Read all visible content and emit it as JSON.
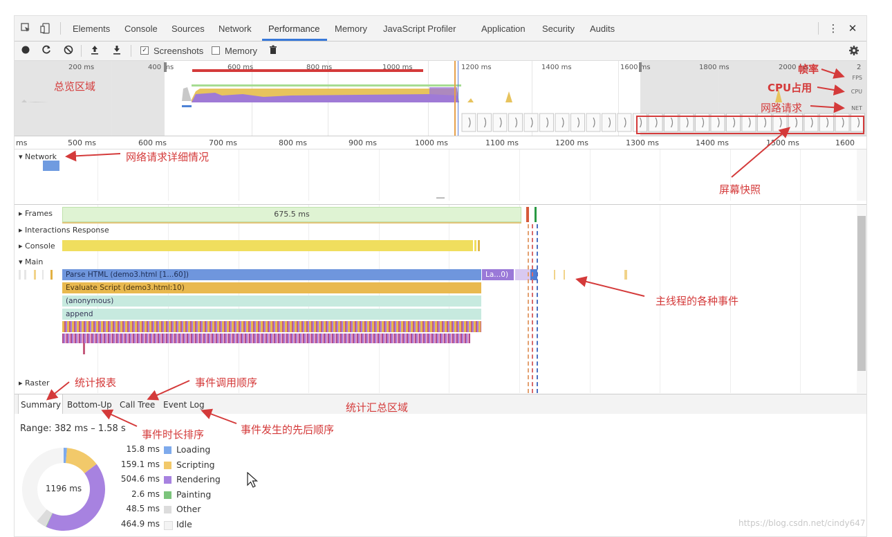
{
  "tabs": [
    "Elements",
    "Console",
    "Sources",
    "Network",
    "Performance",
    "Memory",
    "JavaScript Profiler",
    "Application",
    "Security",
    "Audits"
  ],
  "toolbar": {
    "screenshots_label": "Screenshots",
    "memory_label": "Memory"
  },
  "overview": {
    "ticks": [
      "200 ms",
      "400 ms",
      "600 ms",
      "800 ms",
      "1000 ms",
      "1200 ms",
      "1400 ms",
      "1600 ms",
      "1800 ms",
      "2000 ms",
      "2"
    ],
    "fps_label": "FPS",
    "cpu_label": "CPU",
    "net_label": "NET"
  },
  "ruler": {
    "ticks": [
      "ms",
      "500 ms",
      "600 ms",
      "700 ms",
      "800 ms",
      "900 ms",
      "1000 ms",
      "1100 ms",
      "1200 ms",
      "1300 ms",
      "1400 ms",
      "1500 ms",
      "1600"
    ]
  },
  "network": {
    "label": "Network"
  },
  "tracks": {
    "frames": "Frames",
    "frames_time": "675.5 ms",
    "interactions": "Interactions Response",
    "console": "Console",
    "main": "Main",
    "raster": "Raster"
  },
  "main_events": {
    "parse": "Parse HTML (demo3.html [1...60])",
    "layout": "La...0)",
    "evaluate": "Evaluate Script (demo3.html:10)",
    "anonymous": "(anonymous)",
    "append": "append"
  },
  "bottom_tabs": [
    "Summary",
    "Bottom-Up",
    "Call Tree",
    "Event Log"
  ],
  "summary": {
    "range": "Range: 382 ms – 1.58 s",
    "total": "1196 ms",
    "items": [
      {
        "value": "15.8 ms",
        "name": "Loading",
        "color": "#7eaaec",
        "ms": 15.8
      },
      {
        "value": "159.1 ms",
        "name": "Scripting",
        "color": "#f2c96a",
        "ms": 159.1
      },
      {
        "value": "504.6 ms",
        "name": "Rendering",
        "color": "#a782e0",
        "ms": 504.6
      },
      {
        "value": "2.6 ms",
        "name": "Painting",
        "color": "#7cc47c",
        "ms": 2.6
      },
      {
        "value": "48.5 ms",
        "name": "Other",
        "color": "#dcdcdc",
        "ms": 48.5
      },
      {
        "value": "464.9 ms",
        "name": "Idle",
        "color": "#f4f4f4",
        "ms": 464.9
      }
    ]
  },
  "annotations": {
    "overview": "总览区域",
    "fps": "帧率",
    "cpu": "CPU占用",
    "net": "网路请求",
    "network_detail": "网络请求详细情况",
    "screenshots": "屏幕快照",
    "main_events": "主线程的各种事件",
    "stats_report": "统计报表",
    "call_order": "事件调用顺序",
    "summary_area": "统计汇总区域",
    "duration_sort": "事件时长排序",
    "event_order": "事件发生的先后顺序"
  },
  "watermark": "https://blog.csdn.net/cindy647"
}
